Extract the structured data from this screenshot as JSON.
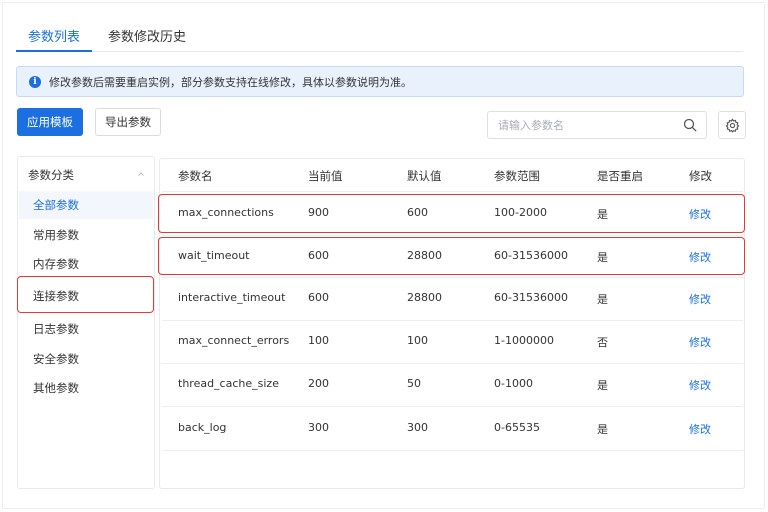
{
  "tabs": [
    {
      "label": "参数列表",
      "active": true
    },
    {
      "label": "参数修改历史",
      "active": false
    }
  ],
  "banner": {
    "icon": "info-icon",
    "text": "修改参数后需要重启实例，部分参数支持在线修改，具体以参数说明为准。"
  },
  "toolbar": {
    "apply_template_label": "应用模板",
    "export_label": "导出参数",
    "search_placeholder": "请输入参数名"
  },
  "categories": {
    "header": "参数分类",
    "items": [
      {
        "label": "全部参数",
        "active": true
      },
      {
        "label": "常用参数",
        "active": false
      },
      {
        "label": "内存参数",
        "active": false
      },
      {
        "label": "连接参数",
        "active": false,
        "highlighted": true
      },
      {
        "label": "日志参数",
        "active": false
      },
      {
        "label": "安全参数",
        "active": false
      },
      {
        "label": "其他参数",
        "active": false
      }
    ]
  },
  "table": {
    "columns": [
      "参数名",
      "当前值",
      "默认值",
      "参数范围",
      "是否重启",
      "修改"
    ],
    "rows": [
      {
        "name": "max_connections",
        "current": "900",
        "default": "600",
        "range": "100-2000",
        "restart": "是",
        "action": "修改",
        "highlighted": true
      },
      {
        "name": "wait_timeout",
        "current": "600",
        "default": "28800",
        "range": "60-31536000",
        "restart": "是",
        "action": "修改",
        "highlighted": true
      },
      {
        "name": "interactive_timeout",
        "current": "600",
        "default": "28800",
        "range": "60-31536000",
        "restart": "是",
        "action": "修改"
      },
      {
        "name": "max_connect_errors",
        "current": "100",
        "default": "100",
        "range": "1-1000000",
        "restart": "否",
        "action": "修改"
      },
      {
        "name": "thread_cache_size",
        "current": "200",
        "default": "50",
        "range": "0-1000",
        "restart": "是",
        "action": "修改"
      },
      {
        "name": "back_log",
        "current": "300",
        "default": "300",
        "range": "0-65535",
        "restart": "是",
        "action": "修改"
      }
    ]
  },
  "colors": {
    "accent": "#1b6fe0",
    "highlight": "#e03a3a",
    "banner_bg": "#e9f2fc"
  }
}
